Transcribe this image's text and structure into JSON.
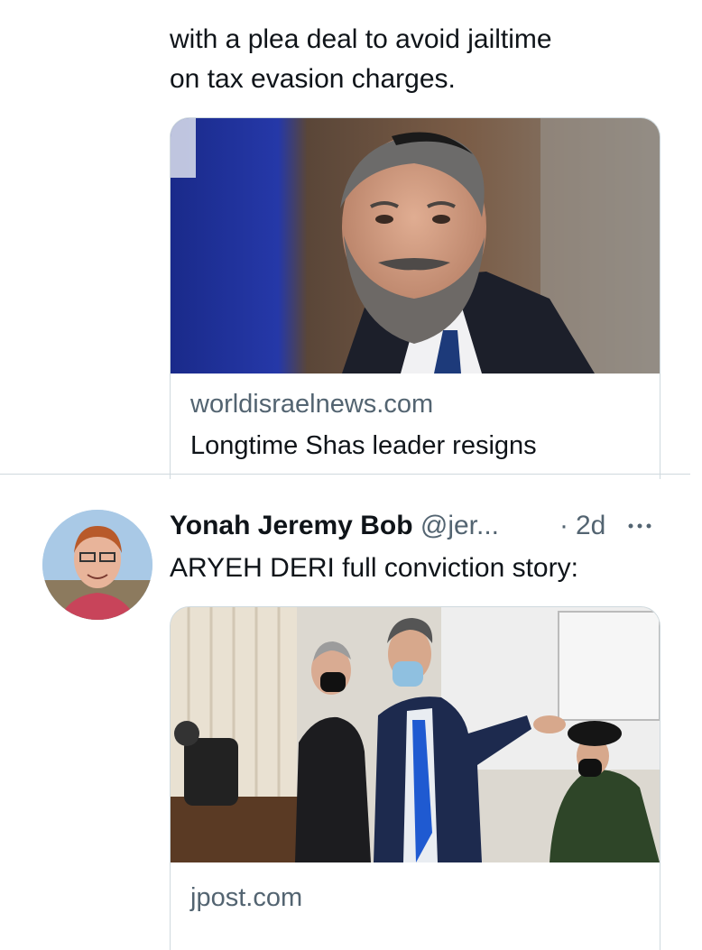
{
  "tweet1": {
    "text_lines": [
      "with a plea deal to avoid jailtime",
      "on tax evasion charges."
    ],
    "card": {
      "domain": "worldisraelnews.com",
      "title": "Longtime Shas leader resigns"
    }
  },
  "tweet2": {
    "author_name": "Yonah Jeremy Bob",
    "handle": "@jer...",
    "separator": "·",
    "time": "2d",
    "more_icon": "more-icon",
    "text": "ARYEH DERI full conviction story:",
    "card": {
      "domain": "jpost.com"
    }
  },
  "colors": {
    "text_primary": "#0f1419",
    "text_secondary": "#536471",
    "border": "#cfd9de"
  }
}
